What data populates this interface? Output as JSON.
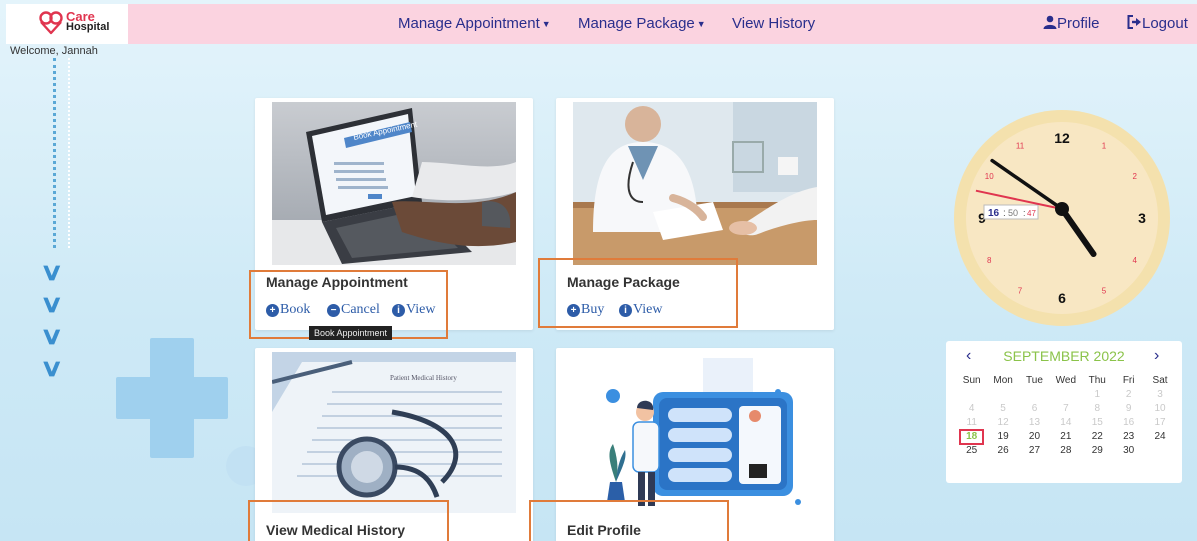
{
  "header": {
    "logo_care": "Care",
    "logo_hospital": "Hospital",
    "nav": [
      {
        "label": "Manage Appointment",
        "dropdown": true
      },
      {
        "label": "Manage Package",
        "dropdown": true
      },
      {
        "label": "View History",
        "dropdown": false
      }
    ],
    "profile_label": "Profile",
    "logout_label": "Logout",
    "welcome": "Welcome, Jannah"
  },
  "cards": [
    {
      "title": "Manage Appointment",
      "actions": [
        "Book",
        "Cancel",
        "View"
      ],
      "image": "laptop-booking-photo"
    },
    {
      "title": "Manage Package",
      "actions": [
        "Buy",
        "View"
      ],
      "image": "doctor-consultation-photo"
    },
    {
      "title": "View Medical History",
      "actions": [],
      "image": "medical-history-stethoscope-photo"
    },
    {
      "title": "Edit Profile",
      "actions": [],
      "image": "doctor-profile-illustration"
    }
  ],
  "card_image_text": {
    "book_appointment": "Book Appointment",
    "patient_medical_history": "Patient Medical History"
  },
  "tooltip": "Book Appointment",
  "clock": {
    "numbers": [
      "12",
      "1",
      "2",
      "3",
      "4",
      "5",
      "6",
      "7",
      "8",
      "9",
      "10",
      "11"
    ],
    "digital_hh": "16",
    "digital_mm": "50",
    "digital_ss": "47",
    "time": {
      "hour": 16,
      "minute": 50,
      "second": 47
    }
  },
  "calendar": {
    "prev": "‹",
    "next": "›",
    "month_label": "SEPTEMBER 2022",
    "weekdays": [
      "Sun",
      "Mon",
      "Tue",
      "Wed",
      "Thu",
      "Fri",
      "Sat"
    ],
    "weeks": [
      [
        "",
        "",
        "",
        "",
        "1",
        "2",
        "3"
      ],
      [
        "4",
        "5",
        "6",
        "7",
        "8",
        "9",
        "10"
      ],
      [
        "11",
        "12",
        "13",
        "14",
        "15",
        "16",
        "17"
      ],
      [
        "18",
        "19",
        "20",
        "21",
        "22",
        "23",
        "24"
      ],
      [
        "25",
        "26",
        "27",
        "28",
        "29",
        "30",
        ""
      ]
    ],
    "today": "18",
    "muted_before_today": true
  },
  "colors": {
    "navbar": "#fbd3e0",
    "nav_text": "#2a2e8c",
    "highlight_box": "#e07b3a",
    "calendar_month": "#8bc34a",
    "today_border": "#e0354f"
  }
}
